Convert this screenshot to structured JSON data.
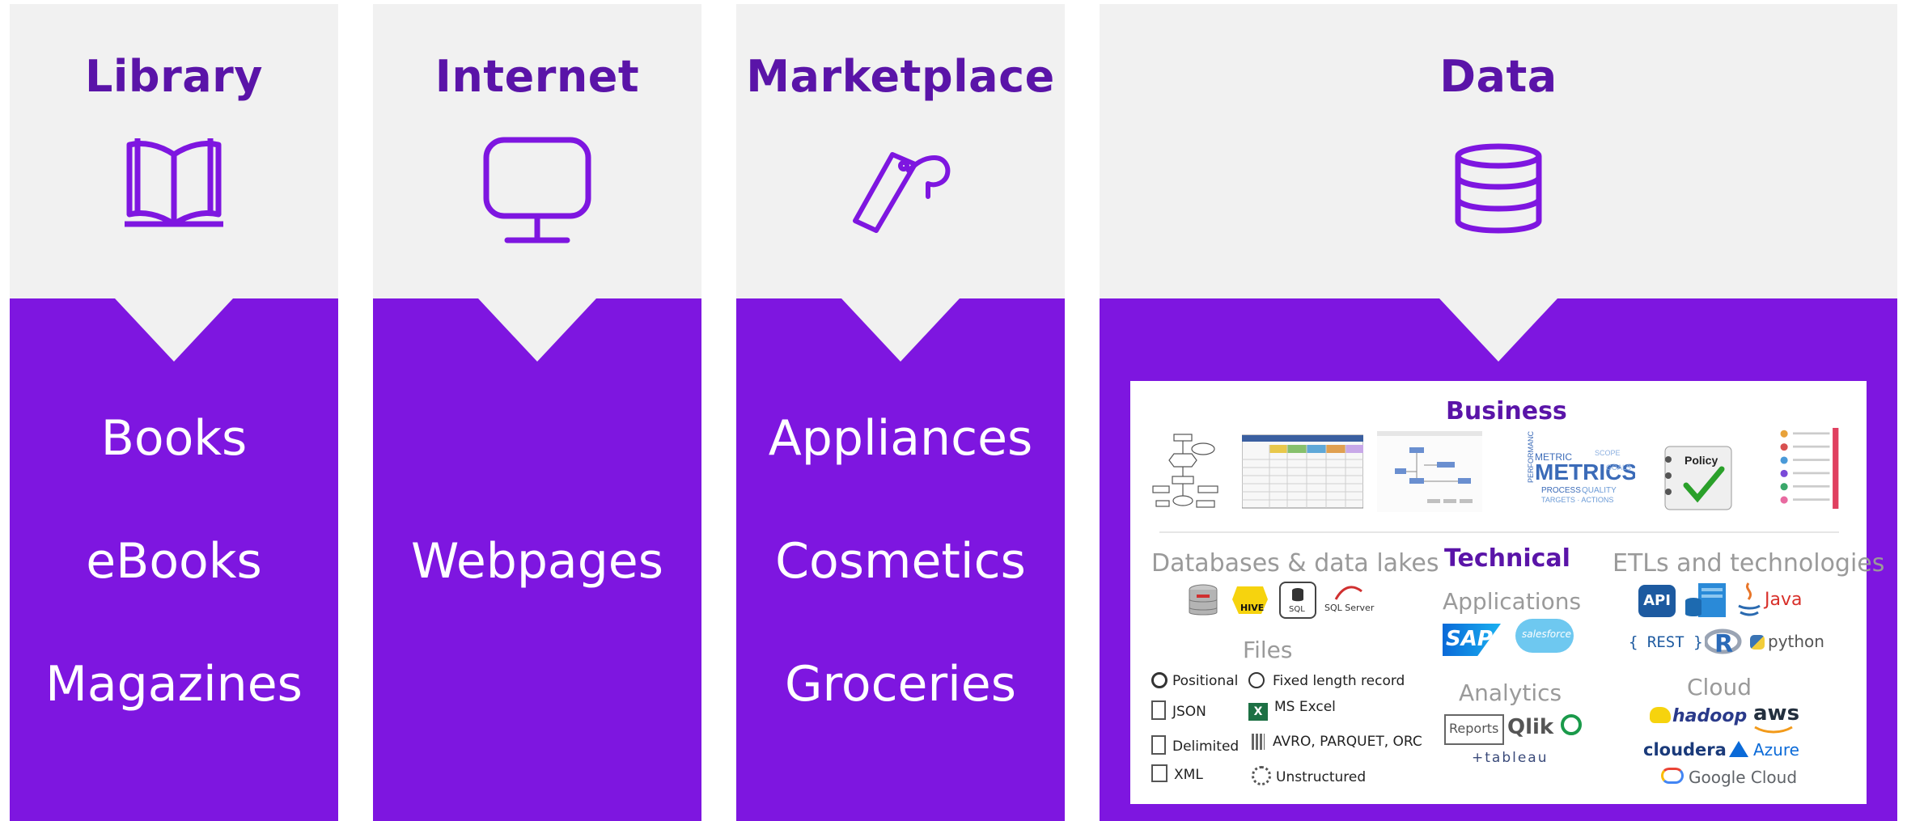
{
  "columns": [
    {
      "title": "Library",
      "icon": "book-icon",
      "items": [
        "Books",
        "eBooks",
        "Magazines"
      ]
    },
    {
      "title": "Internet",
      "icon": "monitor-icon",
      "items": [
        "Webpages"
      ]
    },
    {
      "title": "Marketplace",
      "icon": "price-tag-icon",
      "items": [
        "Appliances",
        "Cosmetics",
        "Groceries"
      ]
    },
    {
      "title": "Data",
      "icon": "database-icon",
      "items": []
    }
  ],
  "data_panel": {
    "business": {
      "title": "Business",
      "thumbnail_words": {
        "metrics": "METRICS",
        "policy": "Policy"
      }
    },
    "technical_title": "Technical",
    "databases": {
      "title": "Databases & data lakes",
      "logos": [
        "HIVE",
        "SQL",
        "SQL Server"
      ]
    },
    "files": {
      "title": "Files",
      "items": [
        "Positional",
        "Fixed length record",
        "JSON",
        "MS Excel",
        "Delimited",
        "AVRO, PARQUET, ORC",
        "XML",
        "Unstructured"
      ]
    },
    "applications": {
      "title": "Applications",
      "logos": [
        "SAP",
        "salesforce"
      ]
    },
    "analytics": {
      "title": "Analytics",
      "logos": [
        "Reports",
        "Qlik",
        "+tableau"
      ]
    },
    "etl": {
      "title": "ETLs and technologies",
      "logos": [
        "API",
        "Java",
        "{ REST }",
        "R",
        "python"
      ]
    },
    "cloud": {
      "title": "Cloud",
      "logos": [
        "hadoop",
        "aws",
        "cloudera",
        "Azure",
        "Google Cloud"
      ]
    }
  }
}
